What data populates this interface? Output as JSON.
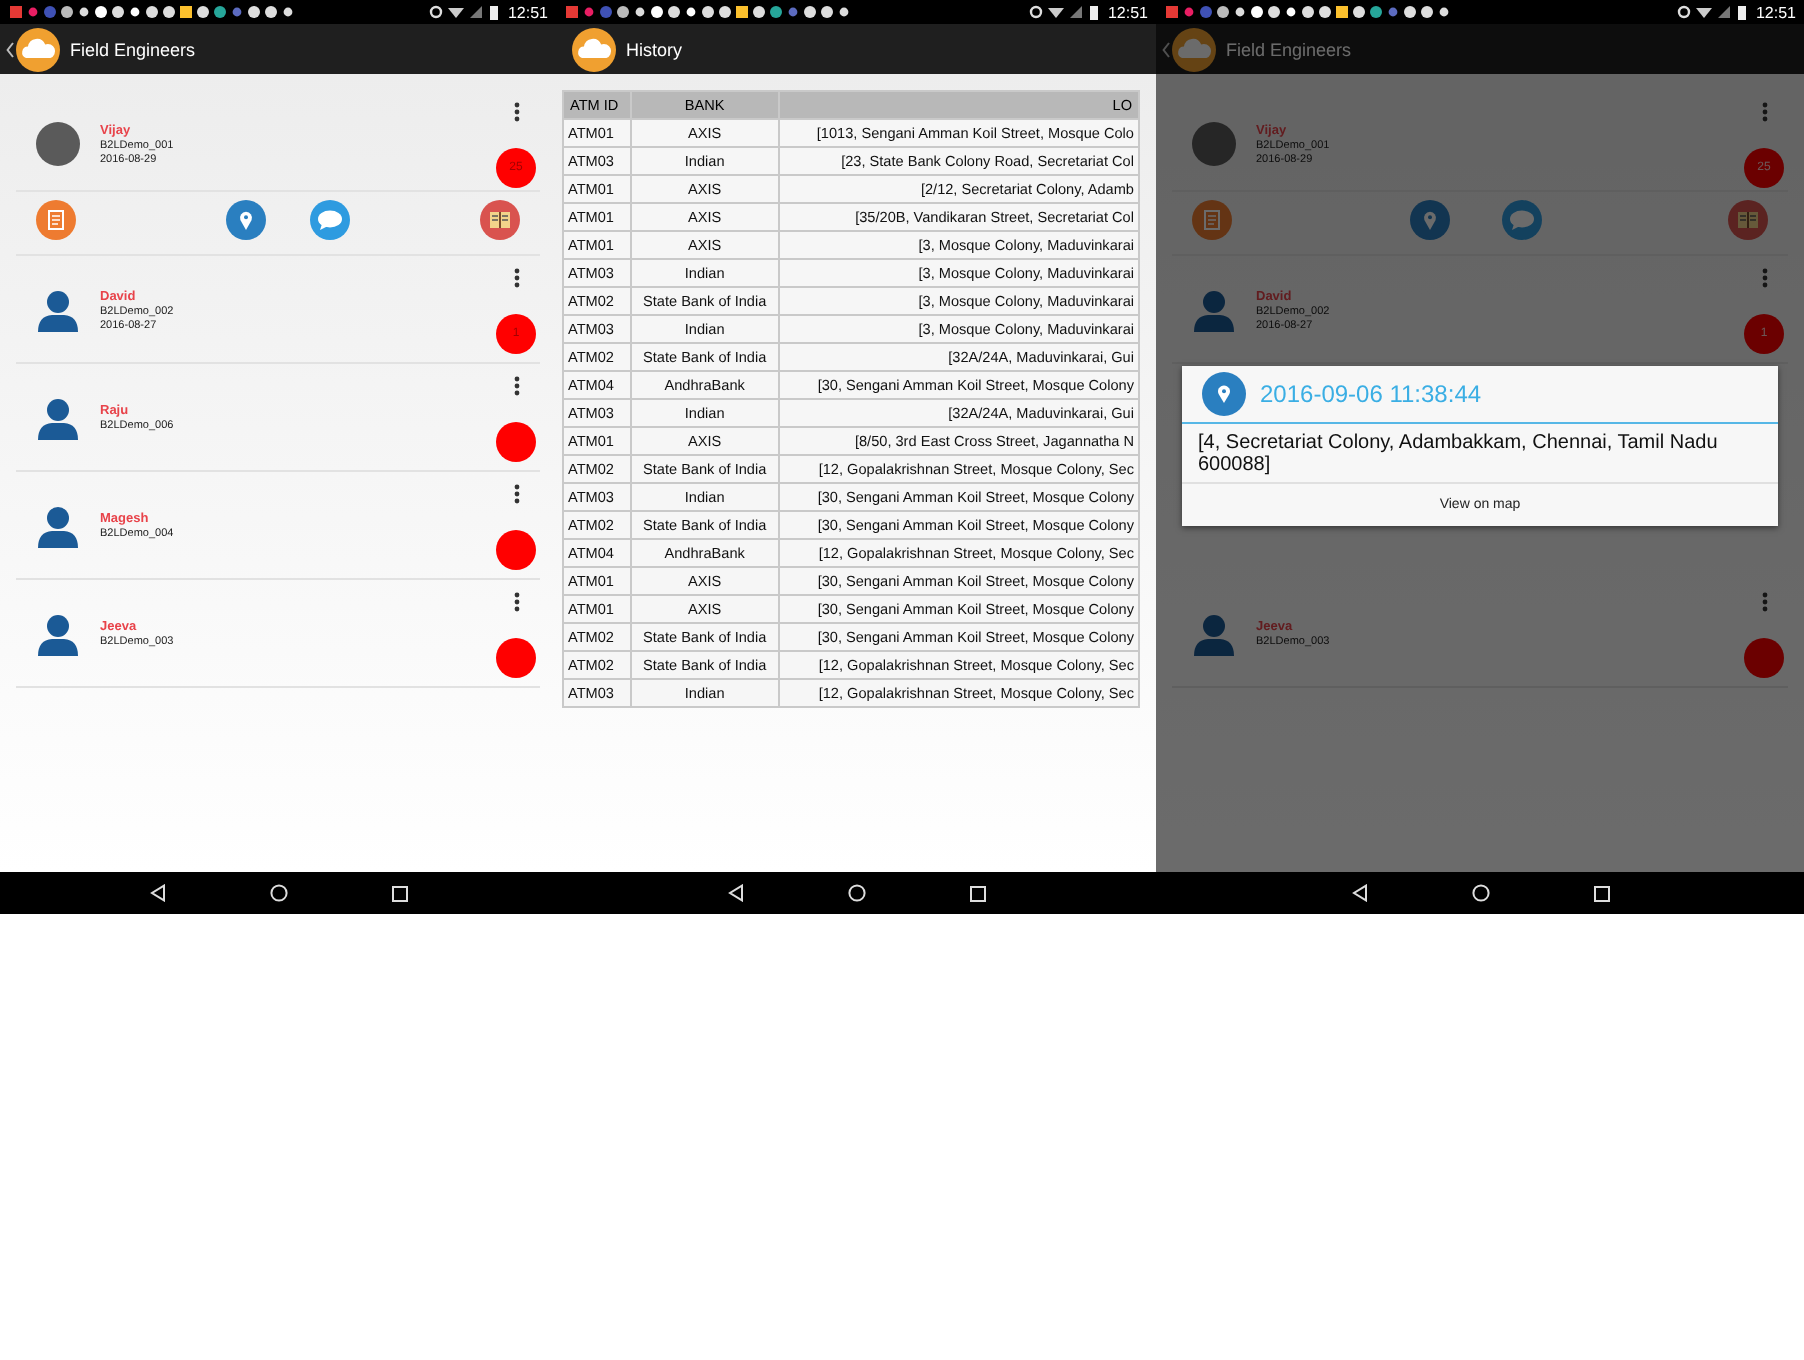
{
  "screens": [
    {
      "kind": "engineers",
      "dimmed": false,
      "status_bar": {
        "time": "12:51"
      },
      "app_bar": {
        "title": "Field Engineers",
        "back": true
      },
      "engineers": [
        {
          "name": "Vijay",
          "code": "B2LDemo_001",
          "date": "2016-08-29",
          "kind": "photo",
          "badge": "25",
          "expanded": true
        },
        {
          "name": "David",
          "code": "B2LDemo_002",
          "date": "2016-08-27",
          "kind": "silhouette",
          "badge": "1",
          "expanded": false
        },
        {
          "name": "Raju",
          "code": "B2LDemo_006",
          "kind": "silhouette",
          "expanded": false
        },
        {
          "name": "Magesh",
          "code": "B2LDemo_004",
          "kind": "silhouette",
          "expanded": false
        },
        {
          "name": "Jeeva",
          "code": "B2LDemo_003",
          "kind": "silhouette",
          "expanded": false
        }
      ]
    },
    {
      "kind": "history",
      "dimmed": false,
      "status_bar": {
        "time": "12:51"
      },
      "app_bar": {
        "title": "History",
        "back": false
      },
      "table": {
        "columns": [
          "ATM ID",
          "BANK",
          "LO"
        ],
        "rows": [
          [
            "ATM01",
            "AXIS",
            "[1013, Sengani Amman Koil Street, Mosque Colo"
          ],
          [
            "ATM03",
            "Indian",
            "[23, State Bank Colony Road, Secretariat Col"
          ],
          [
            "ATM01",
            "AXIS",
            "[2/12, Secretariat Colony, Adamb"
          ],
          [
            "ATM01",
            "AXIS",
            "[35/20B, Vandikaran Street, Secretariat Col"
          ],
          [
            "ATM01",
            "AXIS",
            "[3, Mosque Colony, Maduvinkarai"
          ],
          [
            "ATM03",
            "Indian",
            "[3, Mosque Colony, Maduvinkarai"
          ],
          [
            "ATM02",
            "State Bank of India",
            "[3, Mosque Colony, Maduvinkarai"
          ],
          [
            "ATM03",
            "Indian",
            "[3, Mosque Colony, Maduvinkarai"
          ],
          [
            "ATM02",
            "State Bank of India",
            "[32A/24A, Maduvinkarai, Gui"
          ],
          [
            "ATM04",
            "AndhraBank",
            "[30, Sengani Amman Koil Street, Mosque Colony"
          ],
          [
            "ATM03",
            "Indian",
            "[32A/24A, Maduvinkarai, Gui"
          ],
          [
            "ATM01",
            "AXIS",
            "[8/50, 3rd East Cross Street, Jagannatha N"
          ],
          [
            "ATM02",
            "State Bank of India",
            "[12, Gopalakrishnan Street, Mosque Colony, Sec"
          ],
          [
            "ATM03",
            "Indian",
            "[30, Sengani Amman Koil Street, Mosque Colony"
          ],
          [
            "ATM02",
            "State Bank of India",
            "[30, Sengani Amman Koil Street, Mosque Colony"
          ],
          [
            "ATM04",
            "AndhraBank",
            "[12, Gopalakrishnan Street, Mosque Colony, Sec"
          ],
          [
            "ATM01",
            "AXIS",
            "[30, Sengani Amman Koil Street, Mosque Colony"
          ],
          [
            "ATM01",
            "AXIS",
            "[30, Sengani Amman Koil Street, Mosque Colony"
          ],
          [
            "ATM02",
            "State Bank of India",
            "[30, Sengani Amman Koil Street, Mosque Colony"
          ],
          [
            "ATM02",
            "State Bank of India",
            "[12, Gopalakrishnan Street, Mosque Colony, Sec"
          ],
          [
            "ATM03",
            "Indian",
            "[12, Gopalakrishnan Street, Mosque Colony, Sec"
          ]
        ]
      }
    },
    {
      "kind": "engineers",
      "dimmed": true,
      "status_bar": {
        "time": "12:51"
      },
      "app_bar": {
        "title": "Field Engineers",
        "back": true
      },
      "engineers": [
        {
          "name": "Vijay",
          "code": "B2LDemo_001",
          "date": "2016-08-29",
          "kind": "photo",
          "badge": "25",
          "expanded": true
        },
        {
          "name": "David",
          "code": "B2LDemo_002",
          "date": "2016-08-27",
          "kind": "silhouette",
          "badge": "1",
          "expanded": false
        },
        {
          "name": "Jeeva",
          "code": "B2LDemo_003",
          "kind": "silhouette",
          "expanded": false
        }
      ],
      "dialog": {
        "title": "2016-09-06 11:38:44",
        "address": "[4, Secretariat Colony, Adambakkam, Chennai, Tamil Nadu 600088]",
        "button": "View on map"
      }
    }
  ]
}
